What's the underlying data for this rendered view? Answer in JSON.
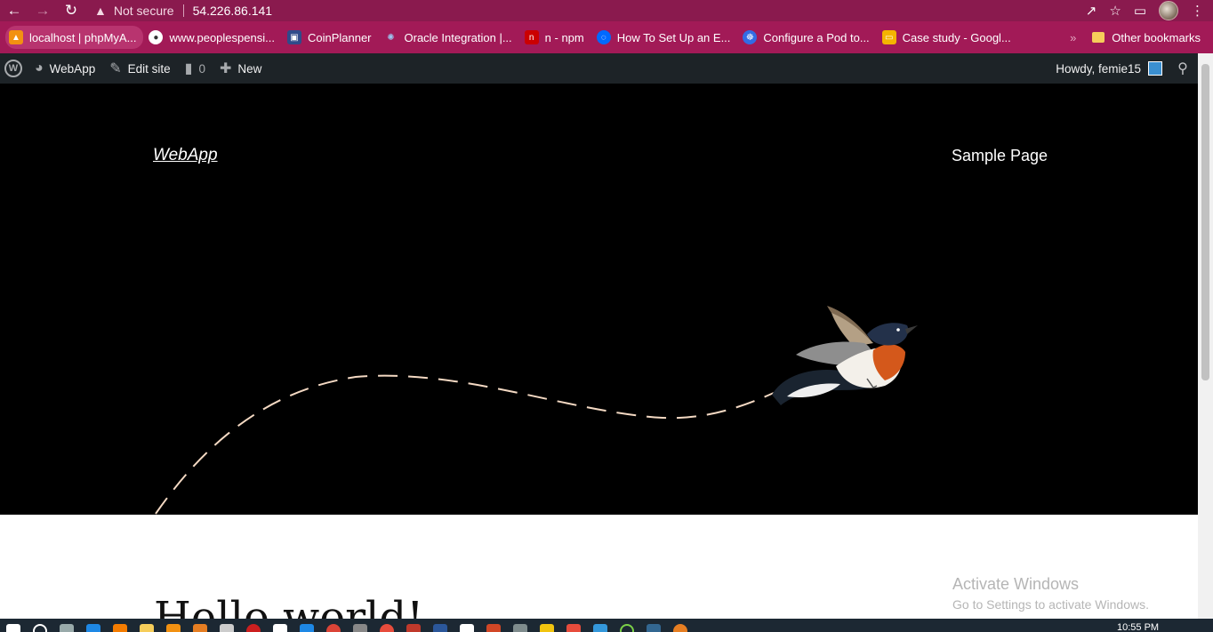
{
  "browser": {
    "security_label": "Not secure",
    "url": "54.226.86.141",
    "bookmarks": [
      {
        "label": "localhost | phpMyA...",
        "icon": "phpmyadmin-icon",
        "color": "#f29111"
      },
      {
        "label": "www.peoplespensi...",
        "icon": "globe-icon",
        "color": "#ffffff"
      },
      {
        "label": "CoinPlanner",
        "icon": "coinplanner-icon",
        "color": "#2f4a8a"
      },
      {
        "label": "Oracle Integration |...",
        "icon": "oracle-integration-icon",
        "color": "#6fa1d9"
      },
      {
        "label": "n - npm",
        "icon": "npm-icon",
        "color": "#cb0000"
      },
      {
        "label": "How To Set Up an E...",
        "icon": "digitalocean-icon",
        "color": "#0069ff"
      },
      {
        "label": "Configure a Pod to...",
        "icon": "kubernetes-icon",
        "color": "#326ce5"
      },
      {
        "label": "Case study - Googl...",
        "icon": "google-slides-icon",
        "color": "#f4b400"
      }
    ],
    "other_bookmarks": "Other bookmarks"
  },
  "wpbar": {
    "site_name": "WebApp",
    "edit_site": "Edit site",
    "comments_count": "0",
    "new_label": "New",
    "howdy": "Howdy, femie15"
  },
  "site": {
    "title": "WebApp",
    "menu_item": "Sample Page"
  },
  "post": {
    "title": "Hello world!"
  },
  "os": {
    "activate_title": "Activate Windows",
    "activate_sub": "Go to Settings to activate Windows.",
    "time": "10:55 PM"
  }
}
